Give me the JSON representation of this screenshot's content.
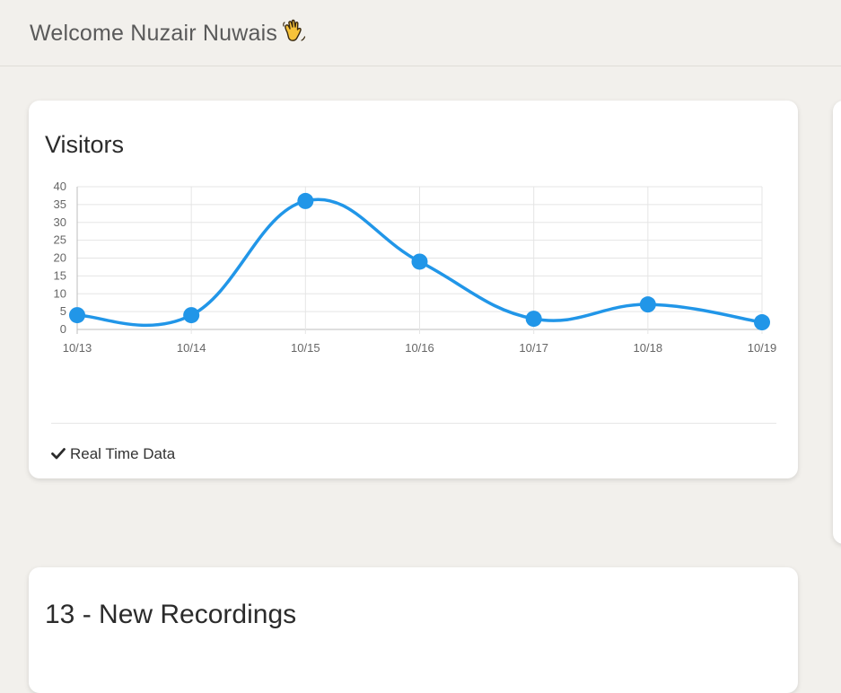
{
  "header": {
    "welcome_text": "Welcome Nuzair Nuwais",
    "emoji_icon": "waving-hand-icon"
  },
  "visitors_card": {
    "title": "Visitors",
    "footer_icon": "check-icon",
    "footer_text": "Real Time Data"
  },
  "recordings_card": {
    "title": "13 - New Recordings"
  },
  "chart_data": {
    "type": "line",
    "categories": [
      "10/13",
      "10/14",
      "10/15",
      "10/16",
      "10/17",
      "10/18",
      "10/19"
    ],
    "series": [
      {
        "values": [
          4,
          4,
          36,
          19,
          3,
          7,
          2
        ]
      }
    ],
    "yticks": [
      "0",
      "5",
      "10",
      "15",
      "20",
      "25",
      "30",
      "35",
      "40"
    ],
    "ylim": [
      0,
      40
    ],
    "grid": true,
    "legend": "none",
    "line_color": "#2196e8"
  }
}
